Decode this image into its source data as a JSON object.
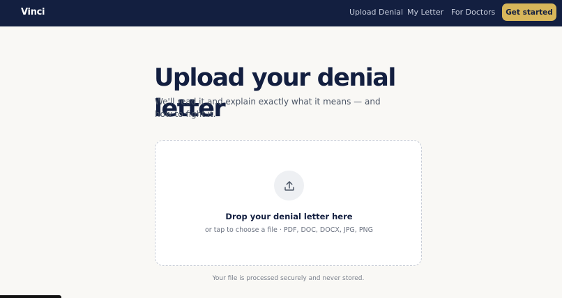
{
  "nav": {
    "brand": "Vinci",
    "links": [
      {
        "label": "Upload Denial"
      },
      {
        "label": "My Letter"
      },
      {
        "label": "For Doctors"
      }
    ],
    "cta": "Get started"
  },
  "hero": {
    "title": "Upload your denial letter",
    "subtitle": "We'll read it and explain exactly what it means — and how to fight it."
  },
  "dropzone": {
    "icon": "upload-icon",
    "title": "Drop your denial letter here",
    "hint": "or tap to choose a file · PDF, DOC, DOCX, JPG, PNG"
  },
  "footnote": "Your file is processed securely and never stored.",
  "colors": {
    "nav_bg": "#131f40",
    "accent": "#d7b65a",
    "page_bg": "#f9f8f5"
  }
}
